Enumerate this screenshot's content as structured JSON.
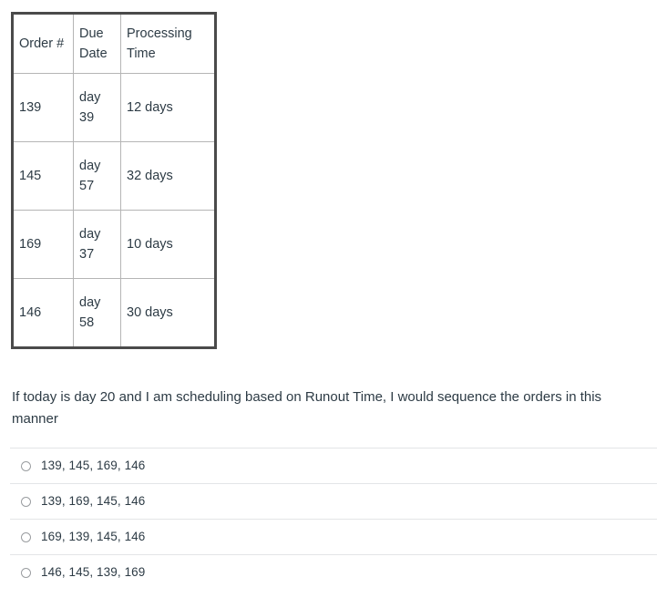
{
  "table": {
    "headers": [
      "Order #",
      "Due Date",
      "Processing Time"
    ],
    "rows": [
      {
        "order": "139",
        "due_date": "day 39",
        "processing_time": "12 days"
      },
      {
        "order": "145",
        "due_date": "day 57",
        "processing_time": "32 days"
      },
      {
        "order": "169",
        "due_date": "day 37",
        "processing_time": "10 days"
      },
      {
        "order": "146",
        "due_date": "day 58",
        "processing_time": "30 days"
      }
    ]
  },
  "question": {
    "prompt": "If today is day 20 and I am scheduling based on Runout Time, I would sequence the orders in this manner"
  },
  "answers": {
    "options": [
      {
        "label": "139, 145, 169, 146"
      },
      {
        "label": "139, 169, 145, 146"
      },
      {
        "label": "169, 139, 145, 146"
      },
      {
        "label": "146, 145, 139, 169"
      }
    ]
  },
  "colors": {
    "text": "#2d3b45",
    "table_outer_border": "#4a4a4a",
    "table_inner_border": "#b5b5b5",
    "divider": "#e3e5e7",
    "radio_border": "#9a9da0",
    "background": "#ffffff"
  }
}
